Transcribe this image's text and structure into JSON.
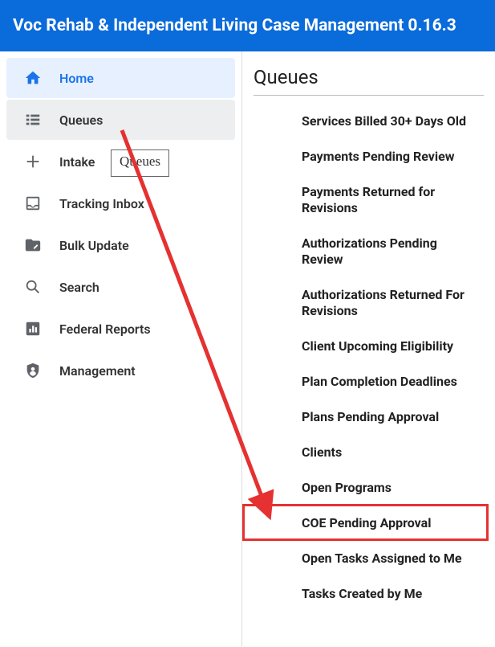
{
  "header": {
    "title": "Voc Rehab & Independent Living Case Management 0.16.3"
  },
  "sidebar": {
    "items": [
      {
        "label": "Home"
      },
      {
        "label": "Queues"
      },
      {
        "label": "Intake"
      },
      {
        "label": "Tracking Inbox"
      },
      {
        "label": "Bulk Update"
      },
      {
        "label": "Search"
      },
      {
        "label": "Federal Reports"
      },
      {
        "label": "Management"
      }
    ]
  },
  "tooltip": {
    "text": "Queues"
  },
  "content": {
    "title": "Queues",
    "queues": [
      "Services Billed 30+ Days Old",
      "Payments Pending Review",
      "Payments Returned for Revisions",
      "Authorizations Pending Review",
      "Authorizations Returned For Revisions",
      "Client Upcoming Eligibility",
      "Plan Completion Deadlines",
      "Plans Pending Approval",
      "Clients",
      "Open Programs",
      "COE Pending Approval",
      "Open Tasks Assigned to Me",
      "Tasks Created by Me"
    ]
  },
  "annotation": {
    "highlight_index": 10,
    "colors": {
      "arrow": "#e53131",
      "highlight": "#e53131",
      "brand": "#0a6bdb"
    }
  }
}
